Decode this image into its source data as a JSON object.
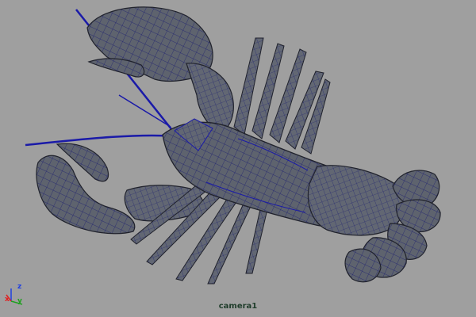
{
  "viewport": {
    "camera_label": "camera1"
  },
  "axis_gizmo": {
    "x_label": "x",
    "y_label": "y",
    "z_label": "z",
    "x_color": "#e02020",
    "y_color": "#20a020",
    "z_color": "#2040e0"
  },
  "model": {
    "body_color": "#5e636e",
    "wire_color": "#1a1aa8",
    "outline_color": "#20222c"
  }
}
